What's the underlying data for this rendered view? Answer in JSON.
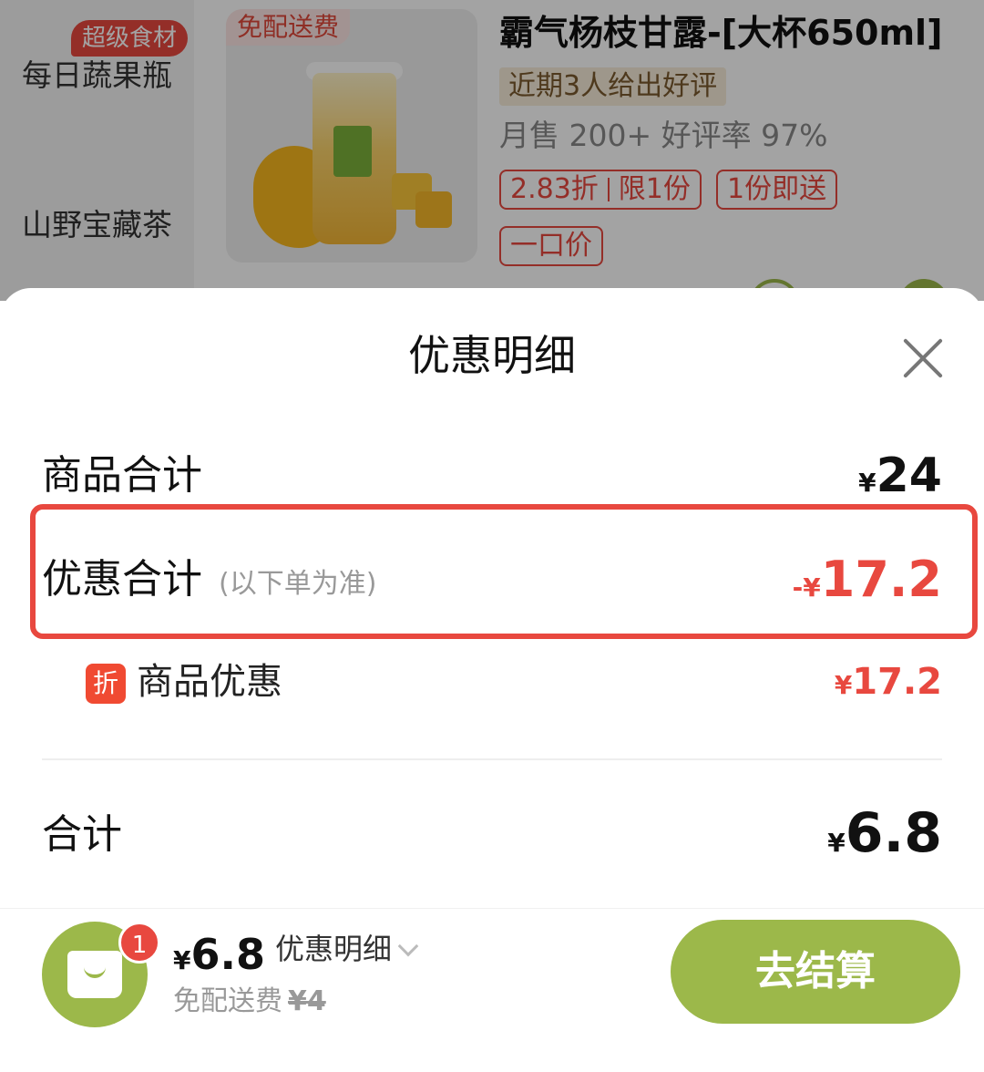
{
  "background": {
    "sidebar": {
      "tag": "超级食材",
      "items": [
        "每日蔬果瓶",
        "山野宝藏茶"
      ]
    },
    "product": {
      "corner_tag": "免配送费",
      "title": "霸气杨枝甘露-[大杯650ml]",
      "review_badge": "近期3人给出好评",
      "sales": "月售 200+ 好评率 97%",
      "promo_discount": "2.83折",
      "promo_limit": "限1份",
      "promo_delivery": "1份即送",
      "promo_fixed": "一口价"
    }
  },
  "sheet": {
    "title": "优惠明细",
    "subtotal": {
      "label": "商品合计",
      "currency": "¥",
      "value": "24"
    },
    "discount": {
      "label": "优惠合计",
      "note": "(以下单为准)",
      "sign": "-¥",
      "value": "17.2"
    },
    "item_discount": {
      "icon_text": "折",
      "label": "商品优惠",
      "currency": "¥",
      "value": "17.2"
    },
    "total": {
      "label": "合计",
      "currency": "¥",
      "value": "6.8"
    }
  },
  "cart_bar": {
    "count": "1",
    "currency": "¥",
    "price": "6.8",
    "detail_link": "优惠明细",
    "delivery_text": "免配送费",
    "delivery_old": "¥4",
    "checkout": "去结算"
  },
  "colors": {
    "accent_green": "#9cb84a",
    "discount_red": "#e8483f"
  }
}
